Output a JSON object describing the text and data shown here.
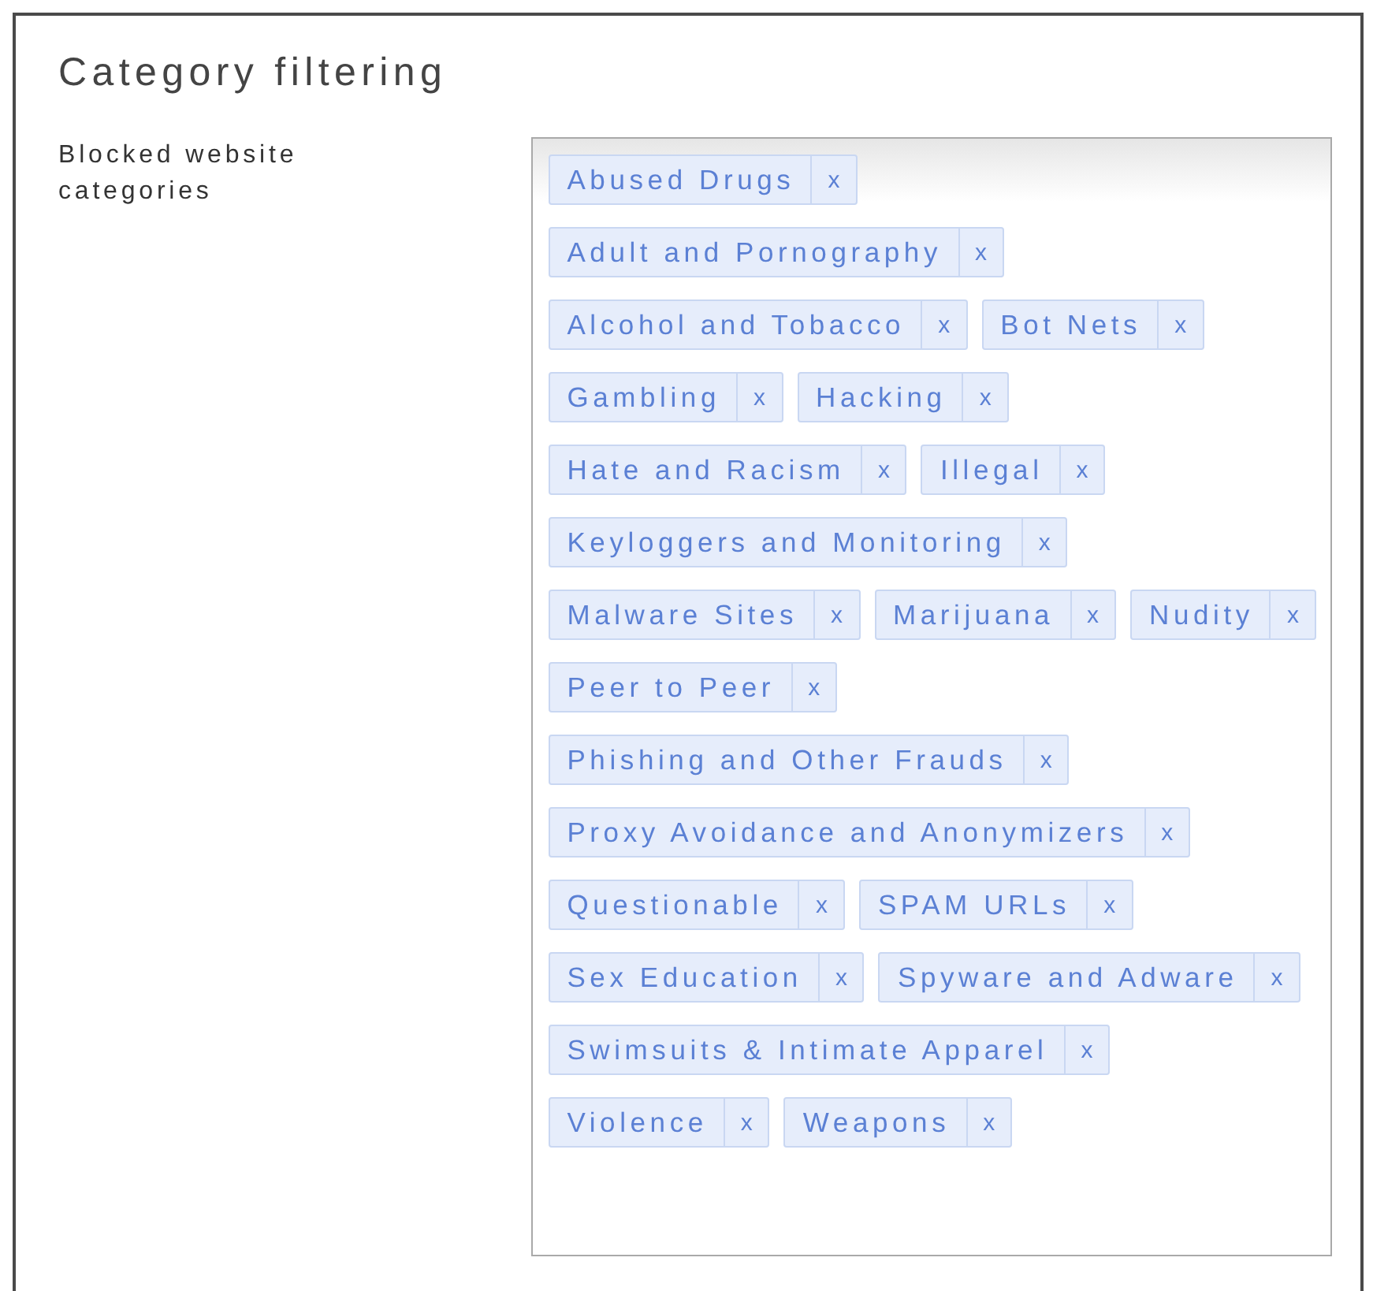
{
  "section": {
    "title": "Category filtering"
  },
  "field": {
    "label": "Blocked website categories",
    "tags": [
      {
        "label": "Abused Drugs",
        "remove": "x"
      },
      {
        "label": "Adult and Pornography",
        "remove": "x"
      },
      {
        "label": "Alcohol and Tobacco",
        "remove": "x"
      },
      {
        "label": "Bot Nets",
        "remove": "x"
      },
      {
        "label": "Gambling",
        "remove": "x"
      },
      {
        "label": "Hacking",
        "remove": "x"
      },
      {
        "label": "Hate and Racism",
        "remove": "x"
      },
      {
        "label": "Illegal",
        "remove": "x"
      },
      {
        "label": "Keyloggers and Monitoring",
        "remove": "x"
      },
      {
        "label": "Malware Sites",
        "remove": "x"
      },
      {
        "label": "Marijuana",
        "remove": "x"
      },
      {
        "label": "Nudity",
        "remove": "x"
      },
      {
        "label": "Peer to Peer",
        "remove": "x"
      },
      {
        "label": "Phishing and Other Frauds",
        "remove": "x"
      },
      {
        "label": "Proxy Avoidance and Anonymizers",
        "remove": "x"
      },
      {
        "label": "Questionable",
        "remove": "x"
      },
      {
        "label": "SPAM URLs",
        "remove": "x"
      },
      {
        "label": "Sex Education",
        "remove": "x"
      },
      {
        "label": "Spyware and Adware",
        "remove": "x"
      },
      {
        "label": "Swimsuits & Intimate Apparel",
        "remove": "x"
      },
      {
        "label": "Violence",
        "remove": "x"
      },
      {
        "label": "Weapons",
        "remove": "x"
      }
    ]
  }
}
